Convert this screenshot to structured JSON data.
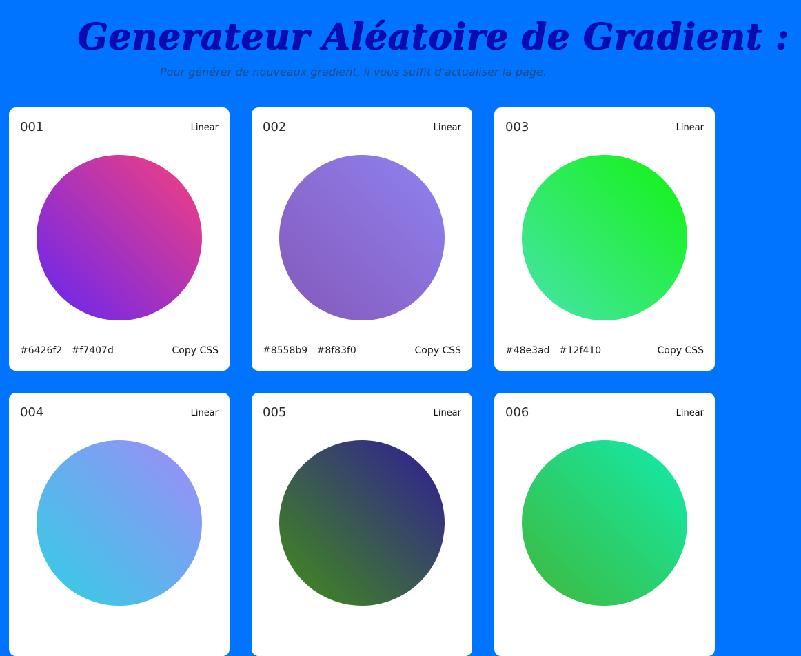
{
  "header": {
    "title": "Generateur Aléatoire de Gradient :",
    "subtitle": "Pour générer de nouveaux gradient, il vous suffit d'actualiser la page."
  },
  "cards": [
    {
      "number": "001",
      "type": "Linear",
      "color1": "#6426f2",
      "color2": "#f7407d",
      "copy_label": "Copy CSS"
    },
    {
      "number": "002",
      "type": "Linear",
      "color1": "#8558b9",
      "color2": "#8f83f0",
      "copy_label": "Copy CSS"
    },
    {
      "number": "003",
      "type": "Linear",
      "color1": "#48e3ad",
      "color2": "#12f410",
      "copy_label": "Copy CSS"
    },
    {
      "number": "004",
      "type": "Linear",
      "color1": "#2fd0e4",
      "color2": "#a18af8",
      "copy_label": ""
    },
    {
      "number": "005",
      "type": "Linear",
      "color1": "#418f16",
      "color2": "#311a98",
      "copy_label": ""
    },
    {
      "number": "006",
      "type": "Linear",
      "color1": "#3fb83a",
      "color2": "#12ecad",
      "copy_label": ""
    }
  ]
}
